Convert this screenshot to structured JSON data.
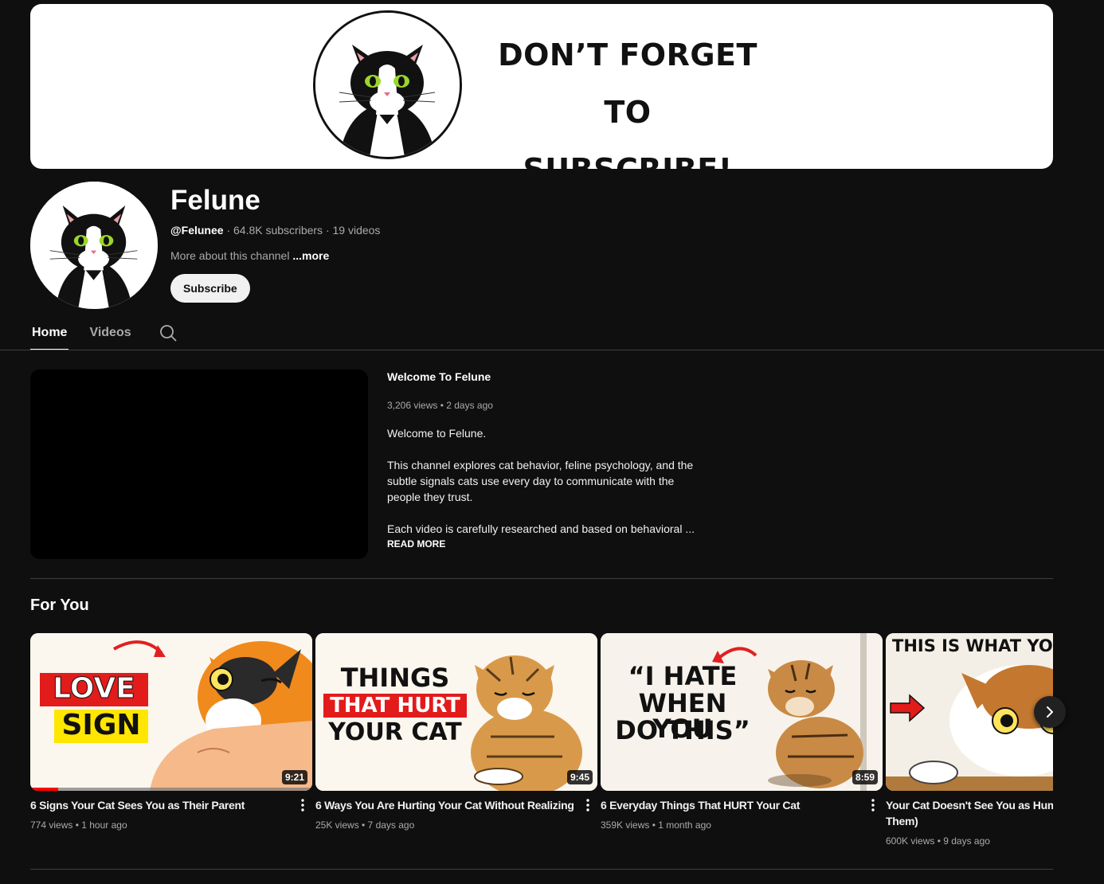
{
  "banner": {
    "line1": "DON’T FORGET TO",
    "line2": "SUBSCRIBE!"
  },
  "channel": {
    "name": "Felune",
    "handle": "@Felunee",
    "stats": " · 64.8K subscribers · 19 videos",
    "about": "More about this channel ",
    "about_more": "...more",
    "subscribe_label": "Subscribe"
  },
  "tabs": [
    {
      "label": "Home",
      "active": true
    },
    {
      "label": "Videos",
      "active": false
    }
  ],
  "featured": {
    "title": "Welcome To Felune",
    "meta": "3,206 views • 2 days ago",
    "desc_p1": "Welcome to Felune.",
    "desc_p2": "This channel explores cat behavior, feline psychology, and the subtle signals cats use every day to communicate with the people they trust.",
    "desc_p3": "Each video is carefully researched and based on behavioral ...",
    "read_more": "READ MORE"
  },
  "shelf": {
    "title": "For You",
    "videos": [
      {
        "title": "6 Signs Your Cat Sees You as Their Parent",
        "meta": "774 views • 1 hour ago",
        "duration": "9:21",
        "progress": 0.1,
        "thumb_line1": "LOVE",
        "thumb_line2": "SIGN"
      },
      {
        "title": "6 Ways You Are Hurting Your Cat Without Realizing",
        "meta": "25K views • 7 days ago",
        "duration": "9:45",
        "thumb_line1": "THINGS",
        "thumb_line2": "THAT HURT",
        "thumb_line3": "YOUR CAT"
      },
      {
        "title": "6 Everyday Things That HURT Your Cat",
        "meta": "359K views • 1 month ago",
        "duration": "8:59",
        "thumb_line1": "“I HATE",
        "thumb_line2": "WHEN YOU",
        "thumb_line3": "DO THIS”"
      },
      {
        "title": "Your Cat Doesn't See You as Hum You Really Are to Them)",
        "meta": "600K views • 9 days ago",
        "thumb_line1": "THIS IS WHAT YOU"
      }
    ]
  },
  "colors": {
    "background": "#0f0f0f",
    "progress": "#ff0000",
    "love_sign_red": "#e21b1b",
    "love_sign_yellow": "#ffe600"
  },
  "icons": {
    "search": "search-icon",
    "menu": "more-vert-icon",
    "next": "chevron-right-icon"
  }
}
